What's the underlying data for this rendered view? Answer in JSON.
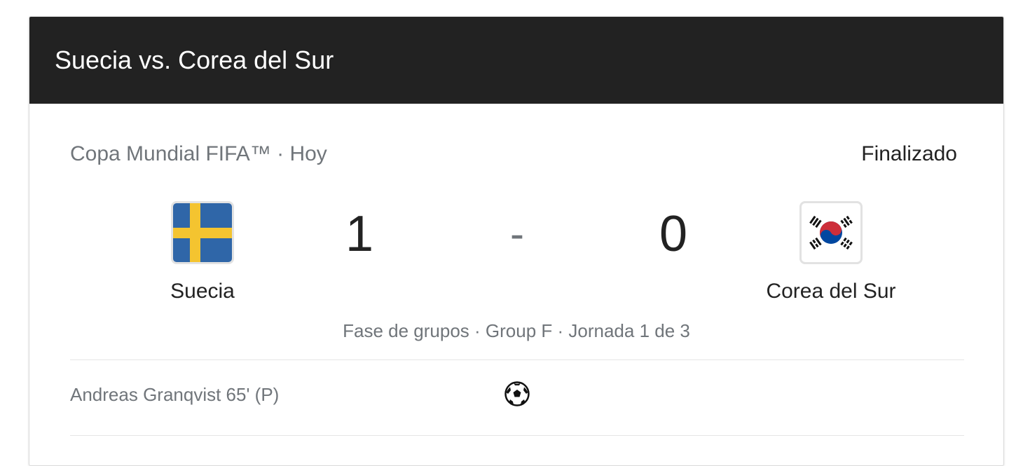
{
  "header": {
    "title": "Suecia vs. Corea del Sur"
  },
  "match": {
    "meta": "Copa Mundial FIFA™ · Hoy",
    "status": "Finalizado",
    "home": {
      "name": "Suecia",
      "flag_icon": "sweden-flag-icon",
      "score": "1"
    },
    "away": {
      "name": "Corea del Sur",
      "flag_icon": "south-korea-flag-icon",
      "score": "0"
    },
    "separator": "-",
    "stage": "Fase de grupos · Group F · Jornada 1 de 3"
  },
  "events": [
    {
      "text": "Andreas Granqvist 65' (P)",
      "icon": "soccer-ball-icon"
    }
  ],
  "colors": {
    "header_bg": "#222222",
    "sweden_blue": "#2f66a8",
    "sweden_yellow": "#f4c430",
    "korea_red": "#cd2e3a",
    "korea_blue": "#0047a0"
  }
}
